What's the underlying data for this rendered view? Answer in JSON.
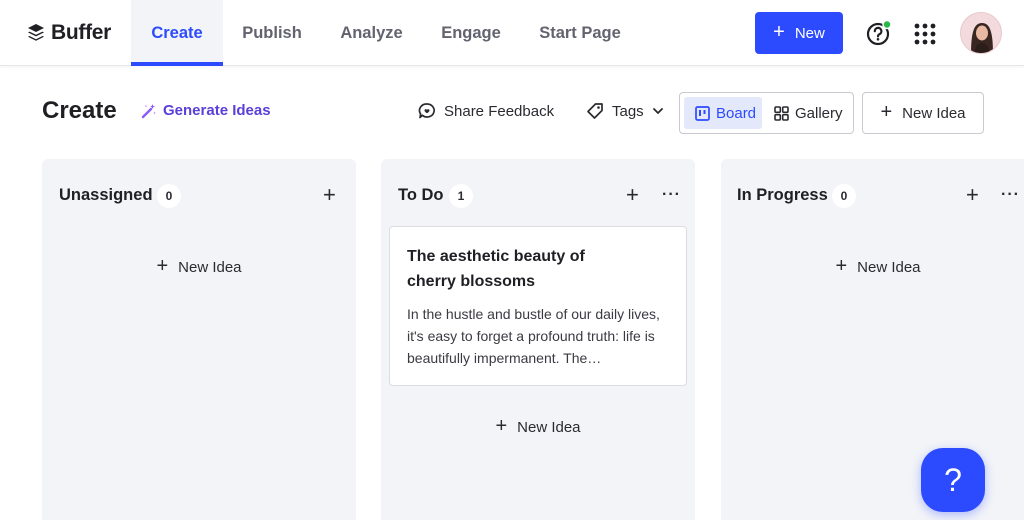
{
  "brand": {
    "name": "Buffer"
  },
  "nav": {
    "tabs": [
      {
        "label": "Create"
      },
      {
        "label": "Publish"
      },
      {
        "label": "Analyze"
      },
      {
        "label": "Engage"
      },
      {
        "label": "Start Page"
      }
    ],
    "active_tab": "Create",
    "new_label": "New"
  },
  "icons": {
    "logo": "buffer-logo-icon",
    "help": "help-circle-icon",
    "apps": "apps-grid-icon",
    "avatar": "user-avatar",
    "generate": "magic-wand-icon",
    "feedback": "chat-bubble-icon",
    "tags": "tag-icon",
    "chevron": "chevron-down-icon",
    "board": "board-icon",
    "gallery": "gallery-icon"
  },
  "colors": {
    "accent": "#2c4bff",
    "generate": "#5b3fd9",
    "column_bg": "#f3f4f8",
    "status_dot": "#28b845"
  },
  "header": {
    "title": "Create",
    "generate_ideas": "Generate Ideas",
    "share_feedback": "Share Feedback",
    "tags": "Tags",
    "board": "Board",
    "gallery": "Gallery",
    "new_idea": "New Idea"
  },
  "columns": [
    {
      "title": "Unassigned",
      "count": "0",
      "new_idea": "New Idea",
      "cards": []
    },
    {
      "title": "To Do",
      "count": "1",
      "new_idea": "New Idea",
      "cards": [
        {
          "title": "The aesthetic beauty of cherry blossoms",
          "body": "In the hustle and bustle of our daily lives, it's easy to forget a profound truth: life is beautifully impermanent. The…"
        }
      ]
    },
    {
      "title": "In Progress",
      "count": "0",
      "new_idea": "New Idea",
      "cards": []
    }
  ],
  "help_fab": {
    "label": "?"
  }
}
